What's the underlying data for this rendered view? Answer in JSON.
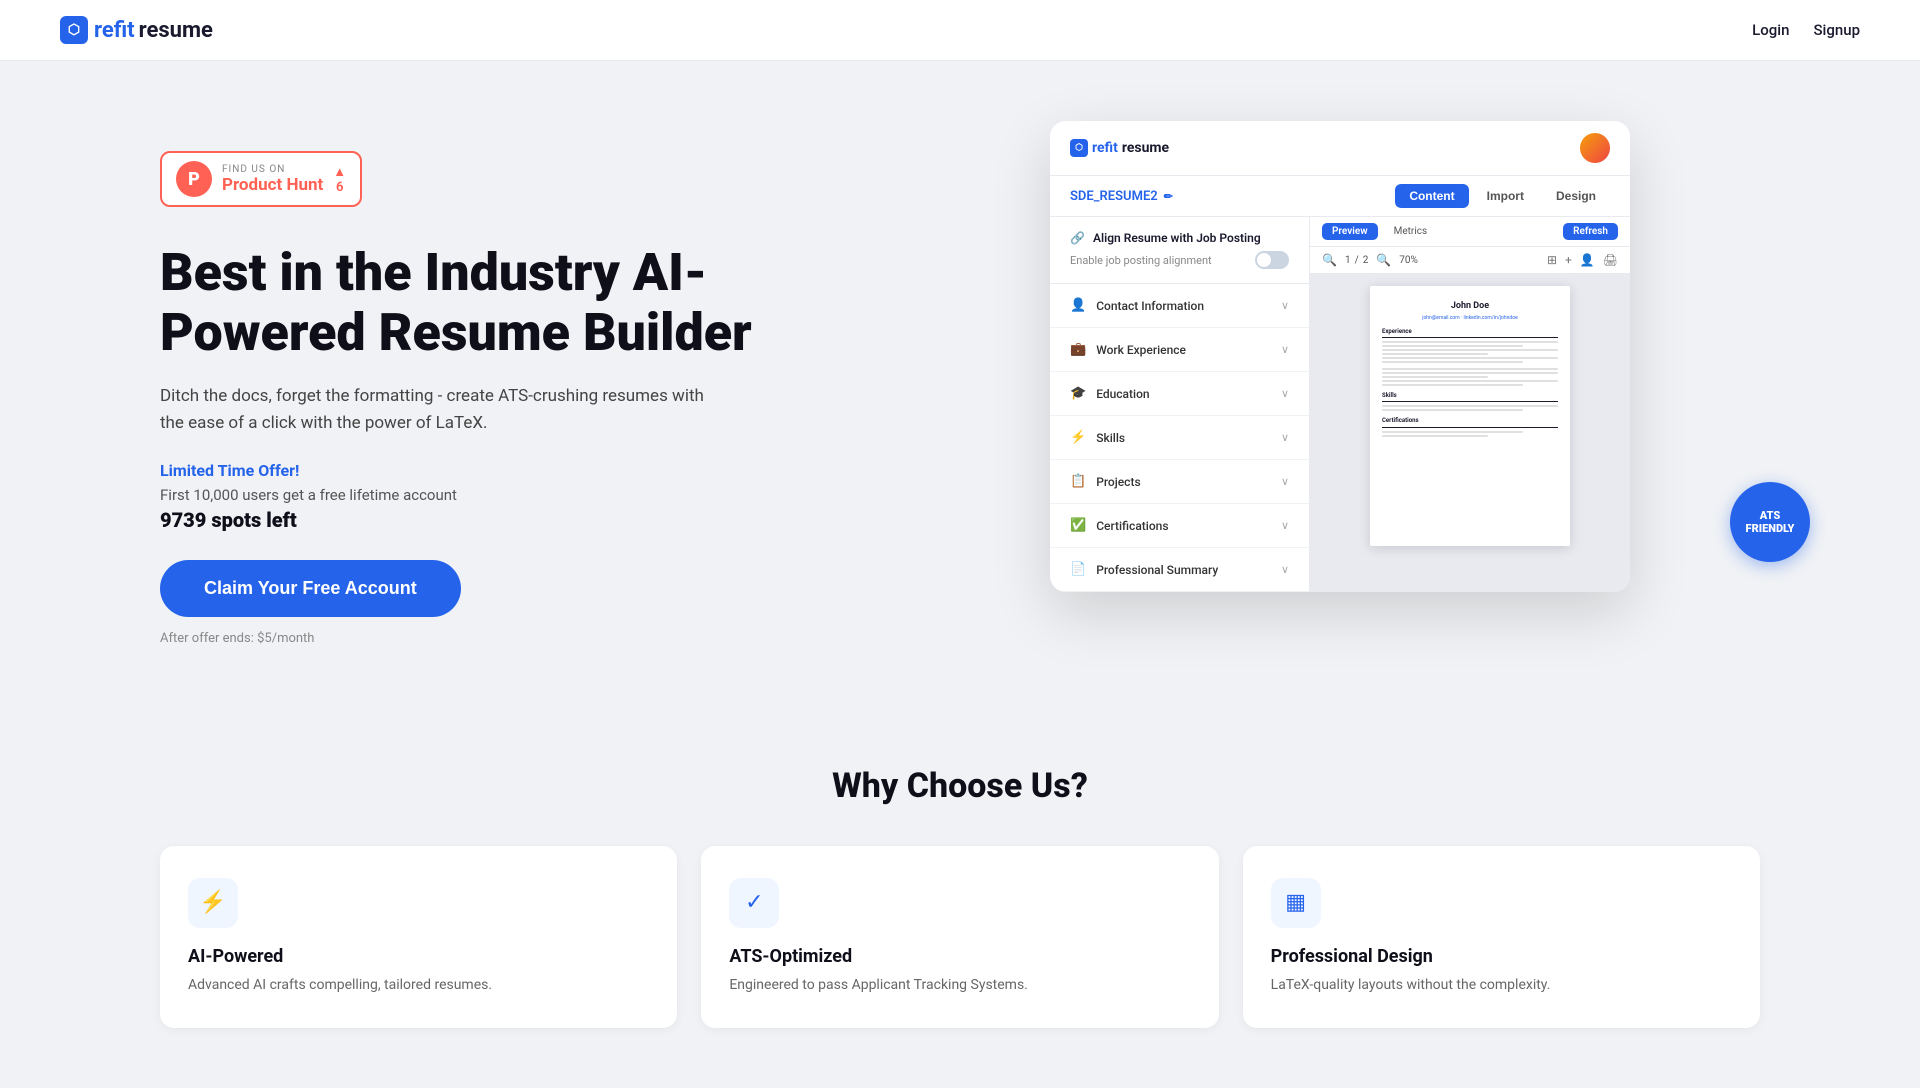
{
  "nav": {
    "logo": {
      "icon": "⬡",
      "refit": "refit",
      "resume": "resume"
    },
    "links": [
      {
        "label": "Login",
        "id": "login"
      },
      {
        "label": "Signup",
        "id": "signup"
      }
    ]
  },
  "hero": {
    "ph_badge": {
      "find": "FIND US ON",
      "name": "Product Hunt",
      "count": "6",
      "arrow": "▲"
    },
    "title": "Best in the Industry AI-Powered Resume Builder",
    "subtitle": "Ditch the docs, forget the formatting - create ATS-crushing resumes with the ease of a click with the power of LaTeX.",
    "limited_offer": "Limited Time Offer!",
    "spots_text": "First 10,000 users get a free lifetime account",
    "spots_count": "9739 spots left",
    "cta_label": "Claim Your Free Account",
    "after_offer": "After offer ends: $5/month"
  },
  "app_mockup": {
    "logo_refit": "refit",
    "logo_resume": "resume",
    "resume_name": "SDE_RESUME2",
    "tabs": [
      "Content",
      "Import",
      "Design"
    ],
    "active_tab": "Content",
    "preview_label": "Preview",
    "metrics_label": "Metrics",
    "refresh_label": "Refresh",
    "page_current": "1",
    "page_separator": "/",
    "page_total": "2",
    "zoom": "70%",
    "align_section": {
      "title": "Align Resume with Job Posting",
      "subtitle": "Enable job posting alignment",
      "icon": "🔗"
    },
    "panel_items": [
      {
        "label": "Contact Information",
        "icon": "👤"
      },
      {
        "label": "Work Experience",
        "icon": "💼"
      },
      {
        "label": "Education",
        "icon": "🎓"
      },
      {
        "label": "Skills",
        "icon": "⚡"
      },
      {
        "label": "Projects",
        "icon": "📋"
      },
      {
        "label": "Certifications",
        "icon": "✅"
      },
      {
        "label": "Professional Summary",
        "icon": "📄"
      }
    ],
    "resume": {
      "name": "John Doe",
      "contact": "john@email.com · linkedin.com/in/johndoe"
    },
    "ats_badge": "ATS\nFRIENDLY"
  },
  "why": {
    "title": "Why Choose Us?",
    "features": [
      {
        "icon": "⚡",
        "title": "AI-Powered",
        "desc": "Advanced AI crafts compelling, tailored resumes."
      },
      {
        "icon": "✓",
        "title": "ATS-Optimized",
        "desc": "Engineered to pass Applicant Tracking Systems."
      },
      {
        "icon": "▦",
        "title": "Professional Design",
        "desc": "LaTeX-quality layouts without the complexity."
      }
    ]
  }
}
